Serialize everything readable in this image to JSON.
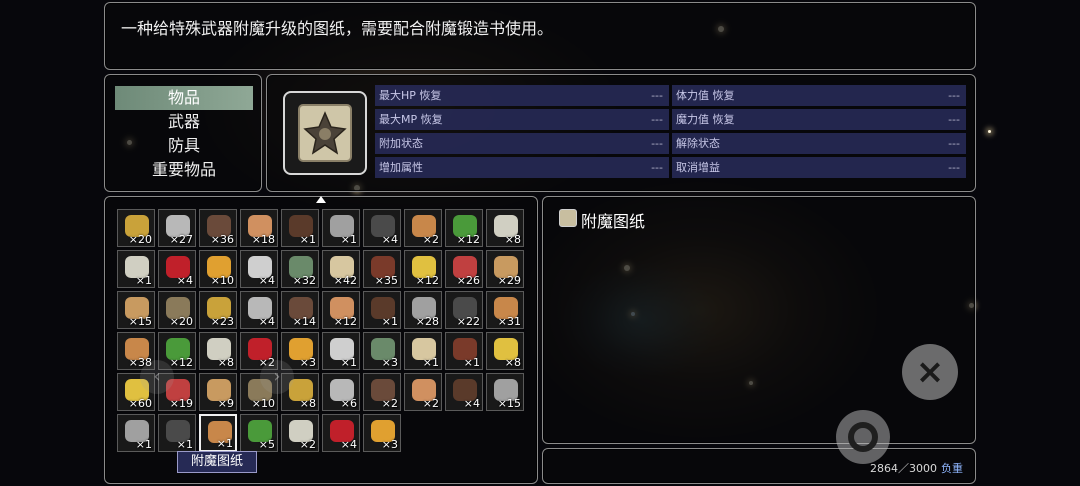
{
  "description": "一种给特殊武器附魔升级的图纸，需要配合附魔锻造书使用。",
  "categories": {
    "items": [
      "物品",
      "武器",
      "防具",
      "重要物品"
    ],
    "selected": "物品"
  },
  "stats": {
    "max_hp_restore": {
      "label": "最大HP 恢复",
      "value": "---"
    },
    "max_mp_restore": {
      "label": "最大MP 恢复",
      "value": "---"
    },
    "add_status": {
      "label": "附加状态",
      "value": "---"
    },
    "add_attribute": {
      "label": "增加属性",
      "value": "---"
    },
    "stamina_restore": {
      "label": "体力值 恢复",
      "value": "---"
    },
    "magic_restore": {
      "label": "魔力值 恢复",
      "value": "---"
    },
    "remove_status": {
      "label": "解除状态",
      "value": "---"
    },
    "cancel_buff": {
      "label": "取消增益",
      "value": "---"
    }
  },
  "selected_item": {
    "name": "附魔图纸",
    "icon": "enchant-blueprint-icon"
  },
  "inventory": {
    "rows": [
      [
        "×20",
        "×27",
        "×36",
        "×18",
        "×1",
        "×1",
        "×4",
        "×2",
        "×12",
        "×8"
      ],
      [
        "×1",
        "×4",
        "×10",
        "×4",
        "×32",
        "×42",
        "×35",
        "×12",
        "×26",
        "×29"
      ],
      [
        "×15",
        "×20",
        "×23",
        "×4",
        "×14",
        "×12",
        "×1",
        "×28",
        "×22",
        "×31"
      ],
      [
        "×38",
        "×12",
        "×8",
        "×2",
        "×3",
        "×1",
        "×3",
        "×1",
        "×1",
        "×8"
      ],
      [
        "×60",
        "×19",
        "×9",
        "×10",
        "×8",
        "×6",
        "×2",
        "×2",
        "×4",
        "×15"
      ],
      [
        "×1",
        "×1",
        "×1",
        "×5",
        "×2",
        "×4",
        "×3"
      ]
    ],
    "selected_slot_label": "附魔图纸"
  },
  "weight": {
    "current": "2864",
    "separator": "／",
    "max": "3000",
    "unit": "负重"
  },
  "buttons": {
    "close": "×"
  },
  "colors": {
    "stat_row_bg": "#282c5a",
    "category_active": "#8fa896",
    "weight_unit": "#8fb6ff"
  }
}
